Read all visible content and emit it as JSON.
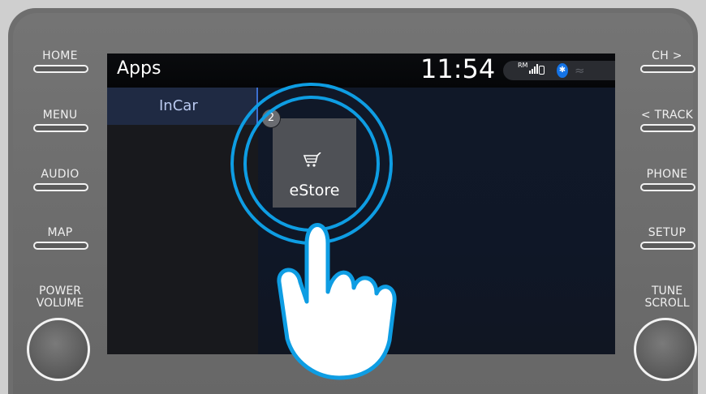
{
  "hardware": {
    "left_buttons": [
      "HOME",
      "MENU",
      "AUDIO",
      "MAP"
    ],
    "right_buttons": [
      "CH >",
      "< TRACK",
      "PHONE",
      "SETUP"
    ],
    "power_volume": [
      "POWER",
      "VOLUME"
    ],
    "tune_scroll": [
      "TUNE",
      "SCROLL"
    ]
  },
  "screen": {
    "title": "Apps",
    "clock": "11:54",
    "status": {
      "roaming": "RM",
      "icons": [
        "signal-icon",
        "phone-icon",
        "bluetooth-icon",
        "wifi-icon"
      ]
    },
    "sidebar": {
      "active_tab": "InCar"
    },
    "app_tile": {
      "label": "eStore",
      "icon": "cart-icon",
      "step_badge": "2"
    }
  },
  "colors": {
    "highlight_ring": "#0e9de3",
    "active_tab_bg": "#1f2a43",
    "bluetooth": "#1473e6"
  }
}
